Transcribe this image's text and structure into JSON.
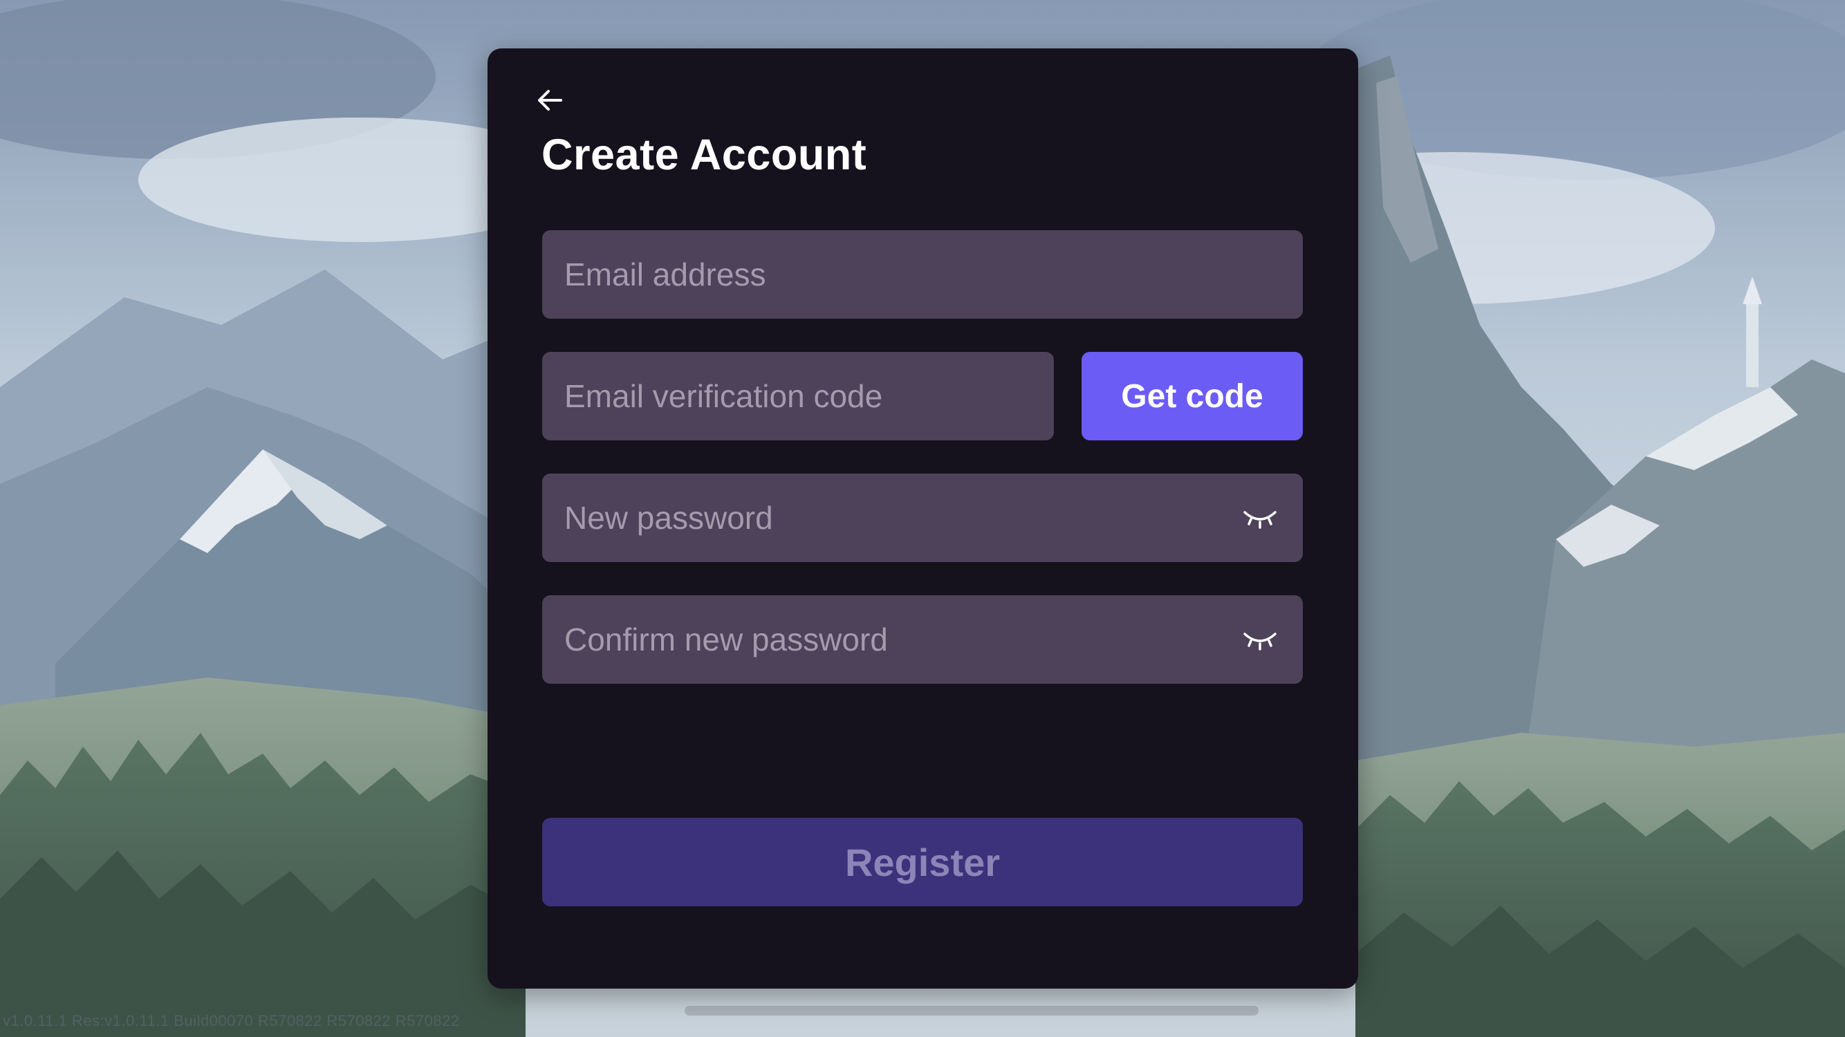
{
  "background": {
    "description": "mountain-landscape",
    "version_text": "v1.0.11.1 Res:v1.0.11.1 Build00070 R570822 R570822 R570822"
  },
  "dialog": {
    "back_icon": "arrow-left-icon",
    "title": "Create Account",
    "email": {
      "placeholder": "Email address",
      "value": ""
    },
    "verification_code": {
      "placeholder": "Email verification code",
      "value": ""
    },
    "get_code_label": "Get code",
    "new_password": {
      "placeholder": "New password",
      "value": "",
      "toggle_icon": "eye-closed-icon"
    },
    "confirm_password": {
      "placeholder": "Confirm new password",
      "value": "",
      "toggle_icon": "eye-closed-icon"
    },
    "register_label": "Register"
  },
  "colors": {
    "dialog_bg": "#15121e",
    "field_bg": "#4d4259",
    "accent": "#6c5cf6",
    "register_disabled_bg": "#3c317b",
    "register_disabled_text": "#8d84b8"
  }
}
